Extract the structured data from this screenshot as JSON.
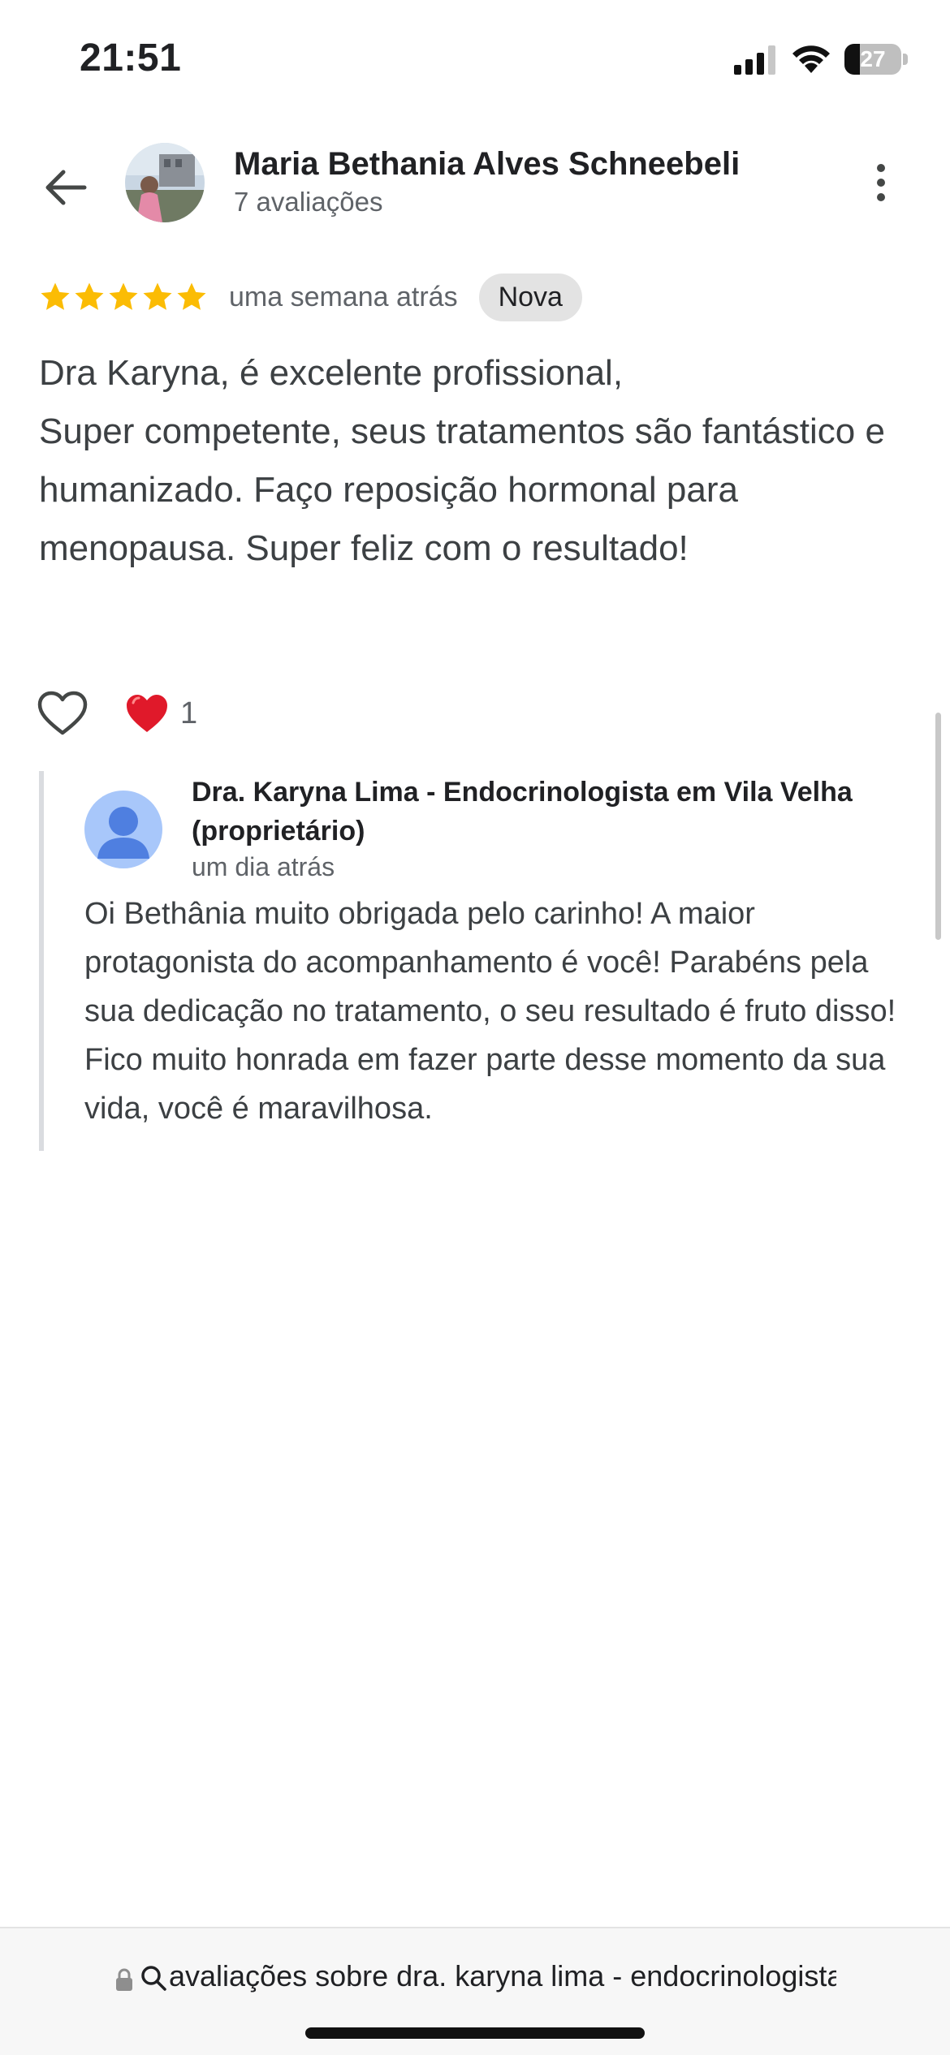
{
  "status_bar": {
    "time": "21:51",
    "battery_level": "27",
    "battery_fraction": 0.27,
    "icons": [
      "signal-icon",
      "wifi-icon",
      "battery-icon"
    ]
  },
  "header": {
    "reviewer_name": "Maria Bethania Alves Schneebeli",
    "reviewer_review_count": "7 avaliações",
    "icons": [
      "back-arrow-icon",
      "more-vert-icon"
    ]
  },
  "review": {
    "rating": 5,
    "rating_max": 5,
    "star_color": "#fbbc04",
    "time": "uma semana atrás",
    "badge": "Nova",
    "text": "Dra Karyna, é excelente profissional,\nSuper competente, seus tratamentos são fantástico e humanizado. Faço reposição hormonal para menopausa. Super feliz com o resultado!",
    "reaction_count": "1",
    "reaction_icons": [
      "heart-outline-icon",
      "red-heart-emoji-icon"
    ]
  },
  "reply": {
    "author": "Dra. Karyna Lima - Endocrinologista em Vila Velha (proprietário)",
    "time": "um dia atrás",
    "text": "Oi Bethânia muito obrigada pelo carinho! A maior protagonista do acompanhamento é você! Parabéns pela sua dedicação no tratamento, o seu resultado é fruto disso! Fico muito honrada em fazer parte desse momento da sua vida, você é maravilhosa.",
    "avatar_color": "#a8c7fa",
    "avatar_icon_color": "#4f7fe0"
  },
  "url_bar": {
    "text": "avaliações sobre dra. karyna lima - endocrinologista",
    "icons": [
      "lock-icon",
      "search-icon"
    ]
  }
}
